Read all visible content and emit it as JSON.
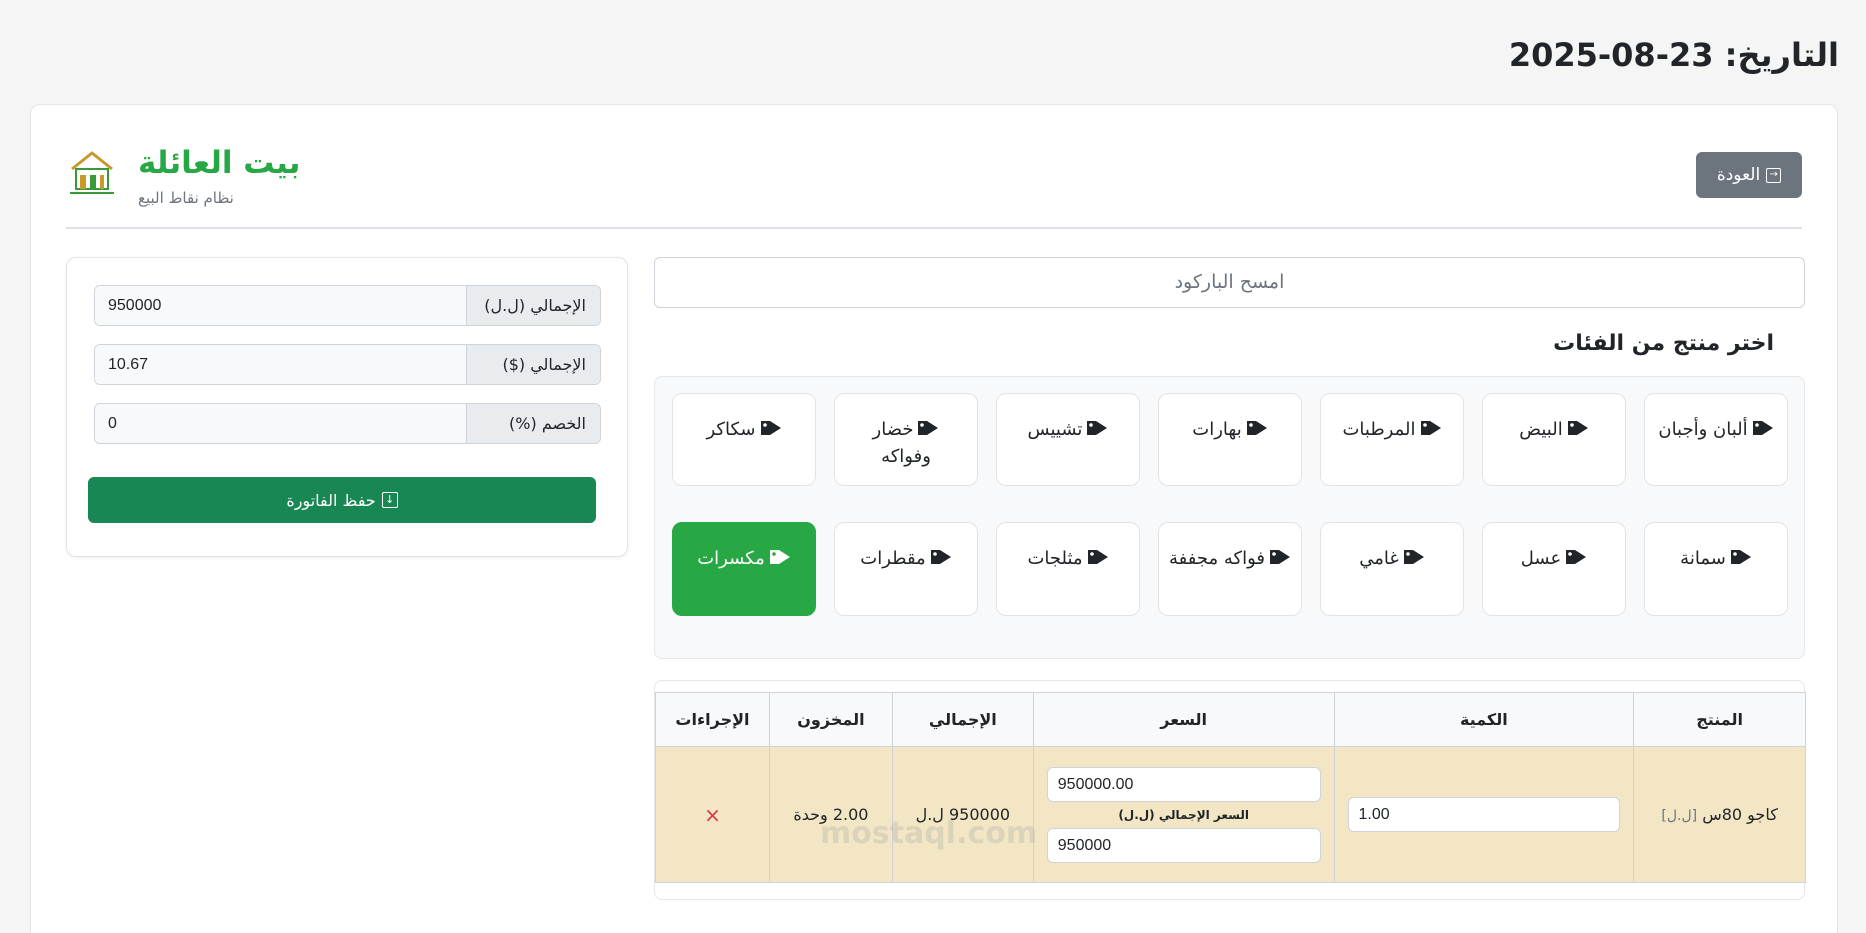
{
  "date": "التاريخ: 23-08-2025",
  "brand": {
    "title": "بيت العائلة",
    "subtitle": "نظام نقاط البيع"
  },
  "back_label": "العودة",
  "totals": [
    {
      "label": "الإجمالي (ل.ل)",
      "value": "950000"
    },
    {
      "label": "الإجمالي ($)",
      "value": "10.67"
    },
    {
      "label": "الخصم (%)",
      "value": "0"
    }
  ],
  "save_label": "حفظ الفاتورة",
  "barcode_placeholder": "امسح الباركود",
  "categories_title": "اختر منتج من الفئات",
  "categories": [
    "ألبان وأجبان",
    "البيض",
    "المرطبات",
    "بهارات",
    "تشييس",
    "خضار وفواكه",
    "سكاكر",
    "سمانة",
    "عسل",
    "غامي",
    "فواكه مجففة",
    "مثلجات",
    "مقطرات",
    "مكسرات"
  ],
  "active_category": "مكسرات",
  "table": {
    "headers": [
      "المنتج",
      "الكمية",
      "السعر",
      "الإجمالي",
      "المخزون",
      "الإجراءات"
    ],
    "rows": [
      {
        "product": "كاجو 80س",
        "currency_tag": "[ل.ل]",
        "quantity": "1.00",
        "price": "950000.00",
        "price_total_label": "السعر الإجمالي (ل.ل)",
        "price_total": "950000",
        "total": "950000 ل.ل",
        "stock": "2.00 وحدة",
        "delete": "×"
      }
    ]
  },
  "watermark": "mostaql.com",
  "colors": {
    "brand": "#28a745",
    "save": "#198754",
    "back": "#6c757d",
    "row_highlight": "#f2e6c4"
  }
}
